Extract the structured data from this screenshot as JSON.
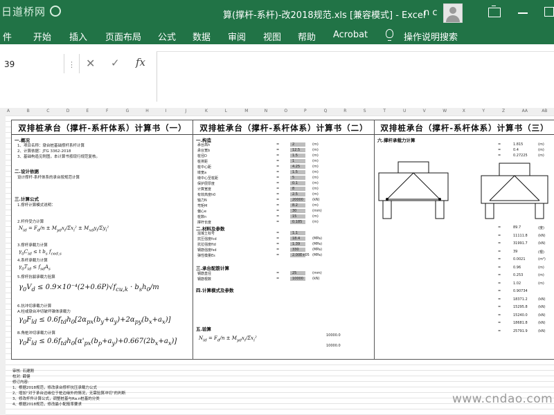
{
  "titlebar": {
    "logo_text": "日道桥网",
    "doc_title": "算(撑杆-系杆)-改2018规范.xls  [兼容模式]  -  Excel",
    "user_initials": "n c"
  },
  "ribbon": {
    "tabs": [
      "件",
      "开始",
      "插入",
      "页面布局",
      "公式",
      "数据",
      "审阅",
      "视图",
      "帮助",
      "Acrobat"
    ],
    "tell_me": "操作说明搜索"
  },
  "formula_bar": {
    "name_box": "39",
    "fx": "fx",
    "content": ""
  },
  "columns": [
    "A",
    "B",
    "C",
    "D",
    "E",
    "F",
    "G",
    "H",
    "I",
    "J",
    "K",
    "L",
    "M",
    "N",
    "O",
    "P",
    "Q",
    "R",
    "S",
    "T",
    "U",
    "V",
    "W",
    "X",
    "Y",
    "Z",
    "AA",
    "AB"
  ],
  "pages": [
    {
      "title": "双排桩承台（撑杆-系杆体系）计算书（一）",
      "sections": [
        "一.概况",
        "二.设计依据",
        "三.计算公式"
      ],
      "lines": [
        "1、项目名称：墩台桩基础撑杆系杆计算",
        "2、计算依据：JTG 3362-2018",
        "3、基础构造见附图，本计算书按现行规范复核。",
        "设计撑杆-系杆体系的承台按规范计算",
        "1.撑杆计算模式说明：",
        "2.杆件受力计算",
        "3.撑杆承载力计算",
        "4.系杆承载力计算",
        "5.撑杆抗裂承载力验算",
        "6.抗冲切承载力计算",
        "A.柱或墩台冲切破坏锥体承载力",
        "B.角桩冲切承载力计算"
      ]
    },
    {
      "title": "双排桩承台（撑杆-系杆体系）计算书（二）",
      "sections": [
        "一.构造",
        "二.材料及参数",
        "三.承台配筋计算",
        "四.计算模式及参数",
        "五.验算"
      ],
      "params": [
        {
          "label": "承台高h",
          "value": "2",
          "unit": "(m)"
        },
        {
          "label": "承台宽b",
          "value": "12.5",
          "unit": "(m)"
        },
        {
          "label": "桩径D",
          "value": "1.5",
          "unit": "(m)"
        },
        {
          "label": "桩排距",
          "value": "1",
          "unit": "(m)"
        },
        {
          "label": "桩中心距",
          "value": "4.25",
          "unit": "(m)"
        },
        {
          "label": "墩宽a",
          "value": "1.5",
          "unit": "(m)"
        },
        {
          "label": "墩中心至桩距",
          "value": "5",
          "unit": "(m)"
        },
        {
          "label": "保护层厚度",
          "value": "0.1",
          "unit": "(m)"
        },
        {
          "label": "计算宽度",
          "value": "8",
          "unit": "(m)"
        },
        {
          "label": "有效高度h0",
          "value": "2.5",
          "unit": "(m)"
        },
        {
          "label": "轴力N",
          "value": "20000",
          "unit": "(kN)"
        },
        {
          "label": "弯矩M",
          "value": "8.2",
          "unit": "(m)"
        },
        {
          "label": "偏心e",
          "value": "30",
          "unit": "(mm)"
        },
        {
          "label": "桩数n",
          "value": "15",
          "unit": "(m)"
        },
        {
          "label": "撑杆长度",
          "value": "0.185",
          "unit": "(m)"
        }
      ],
      "materials": [
        {
          "label": "混凝土标号",
          "value": "1.1",
          "unit": ""
        },
        {
          "label": "抗压强度fcd",
          "value": "18.4",
          "unit": "(MPa)"
        },
        {
          "label": "抗拉强度ftd",
          "value": "1.39",
          "unit": "(MPa)"
        },
        {
          "label": "钢筋强度fsd",
          "value": "330",
          "unit": "(MPa)"
        },
        {
          "label": "弹性模量Es",
          "value": "2.00E+05",
          "unit": "(MPa)"
        }
      ],
      "rebar": [
        {
          "label": "钢筋直径",
          "value": "25",
          "unit": "(mm)"
        },
        {
          "label": "钢筋根数",
          "value": "10000",
          "unit": "(kN)"
        }
      ],
      "result_values": [
        "10000.0",
        "10000.0"
      ]
    },
    {
      "title": "双排桩承台（撑杆-系杆体系）计算书（三）",
      "sections": [
        "六.撑杆承载力计算"
      ],
      "values": [
        "1.815",
        "0.4",
        "0.27225",
        "89.7",
        "11111.8",
        "31991.7",
        "39",
        "0.0021",
        "0.96",
        "0.253",
        "1.02",
        "0.90734",
        "18371.2",
        "15295.8",
        "15240.0",
        "18681.8",
        "25791.9"
      ],
      "units": [
        "(m)",
        "(m)",
        "(m)",
        "(度)",
        "(kN)",
        "(kN)",
        "(根)",
        "(m²)",
        "(m)",
        "(m)",
        "(m)",
        "",
        "(kN)",
        "(kN)",
        "(kN)",
        "(kN)",
        "(kN)"
      ]
    }
  ],
  "footer_notes": [
    "审核: 石建刚",
    "校对: 薛健",
    "修订内容:",
    "1、根据2018规范，修改承台撑杆抗压承载力公式",
    "2、增加“对于承台边缘位于桩边缘外的情况，无需验算冲切”的判断",
    "3、修改杆件计算公式，调整桩基与Ra.n桩基的分类",
    "4、根据2018规范，修改最小配筋率要求"
  ],
  "watermark": "www.cndao.com"
}
